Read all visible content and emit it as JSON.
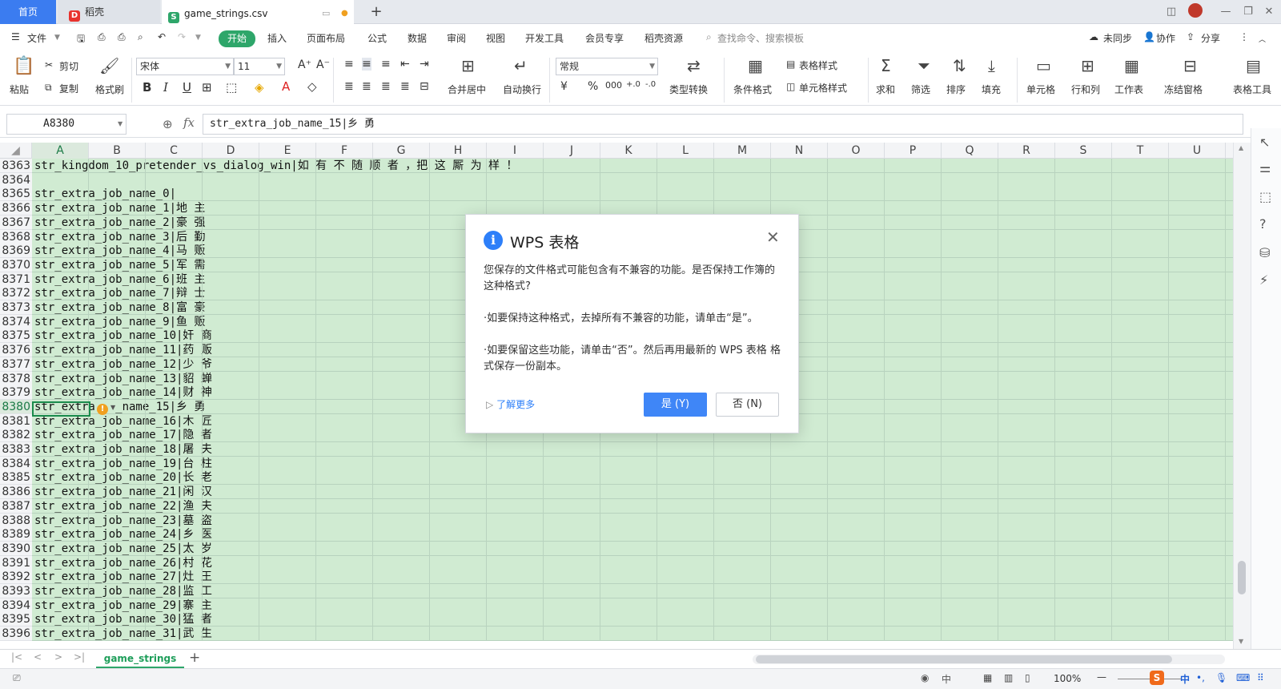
{
  "tabs": {
    "home": "首页",
    "docer": "稻壳",
    "file": "game_strings.csv"
  },
  "menu": [
    "文件",
    "开始",
    "插入",
    "页面布局",
    "公式",
    "数据",
    "审阅",
    "视图",
    "开发工具",
    "会员专享",
    "稻壳资源"
  ],
  "menu_search": "查找命令、搜索模板",
  "menu_right": {
    "sync": "未同步",
    "collab": "协作",
    "share": "分享"
  },
  "ribbon": {
    "paste": "粘贴",
    "cut": "剪切",
    "copy": "复制",
    "format_painter": "格式刷",
    "font": "宋体",
    "font_size": "11",
    "merge": "合并居中",
    "wrap": "自动换行",
    "number_format": "常规",
    "type_convert": "类型转换",
    "cond_format": "条件格式",
    "table_style": "表格样式",
    "cell_style": "单元格样式",
    "sum": "求和",
    "filter": "筛选",
    "sort": "排序",
    "fill": "填充",
    "cell": "单元格",
    "rowcol": "行和列",
    "sheet": "工作表",
    "freeze": "冻结窗格",
    "table_tools": "表格工具"
  },
  "name_box": "A8380",
  "formula": "str_extra_job_name_15|乡 勇",
  "columns": [
    "A",
    "B",
    "C",
    "D",
    "E",
    "F",
    "G",
    "H",
    "I",
    "J",
    "K",
    "L",
    "M",
    "N",
    "O",
    "P",
    "Q",
    "R",
    "S",
    "T",
    "U"
  ],
  "rows": [
    {
      "n": "8363",
      "v": "str_kingdom_10_pretender_vs_dialog_win|如 有 不 随 顺 者 ，把 这 厮 为 样 ！"
    },
    {
      "n": "8364",
      "v": ""
    },
    {
      "n": "8365",
      "v": "str_extra_job_name_0|"
    },
    {
      "n": "8366",
      "v": "str_extra_job_name_1|地 主"
    },
    {
      "n": "8367",
      "v": "str_extra_job_name_2|豪 强"
    },
    {
      "n": "8368",
      "v": "str_extra_job_name_3|后 勤"
    },
    {
      "n": "8369",
      "v": "str_extra_job_name_4|马 贩"
    },
    {
      "n": "8370",
      "v": "str_extra_job_name_5|军 需"
    },
    {
      "n": "8371",
      "v": "str_extra_job_name_6|班 主"
    },
    {
      "n": "8372",
      "v": "str_extra_job_name_7|辩 士"
    },
    {
      "n": "8373",
      "v": "str_extra_job_name_8|富 豪"
    },
    {
      "n": "8374",
      "v": "str_extra_job_name_9|鱼 贩"
    },
    {
      "n": "8375",
      "v": "str_extra_job_name_10|奸 商"
    },
    {
      "n": "8376",
      "v": "str_extra_job_name_11|药 贩"
    },
    {
      "n": "8377",
      "v": "str_extra_job_name_12|少 爷"
    },
    {
      "n": "8378",
      "v": "str_extra_job_name_13|貂 蝉"
    },
    {
      "n": "8379",
      "v": "str_extra_job_name_14|财 神"
    },
    {
      "n": "8380",
      "v": "str_extra   _name_15|乡 勇"
    },
    {
      "n": "8381",
      "v": "str_extra_job_name_16|木 匠"
    },
    {
      "n": "8382",
      "v": "str_extra_job_name_17|隐 者"
    },
    {
      "n": "8383",
      "v": "str_extra_job_name_18|屠 夫"
    },
    {
      "n": "8384",
      "v": "str_extra_job_name_19|台 柱"
    },
    {
      "n": "8385",
      "v": "str_extra_job_name_20|长 老"
    },
    {
      "n": "8386",
      "v": "str_extra_job_name_21|闲 汉"
    },
    {
      "n": "8387",
      "v": "str_extra_job_name_22|渔 夫"
    },
    {
      "n": "8388",
      "v": "str_extra_job_name_23|墓 盗"
    },
    {
      "n": "8389",
      "v": "str_extra_job_name_24|乡 医"
    },
    {
      "n": "8390",
      "v": "str_extra_job_name_25|太 岁"
    },
    {
      "n": "8391",
      "v": "str_extra_job_name_26|村 花"
    },
    {
      "n": "8392",
      "v": "str_extra_job_name_27|灶 王"
    },
    {
      "n": "8393",
      "v": "str_extra_job_name_28|监 工"
    },
    {
      "n": "8394",
      "v": "str_extra_job_name_29|寨 主"
    },
    {
      "n": "8395",
      "v": "str_extra_job_name_30|猛 者"
    },
    {
      "n": "8396",
      "v": "str_extra_job_name_31|武 生"
    }
  ],
  "sheet_tab": "game_strings",
  "zoom": "100%",
  "ime": "中",
  "dialog": {
    "title": "WPS 表格",
    "msg1": "您保存的文件格式可能包含有不兼容的功能。是否保持工作簿的这种格式?",
    "msg2": "·如要保持这种格式，去掉所有不兼容的功能，请单击“是”。",
    "msg3": "·如要保留这些功能，请单击“否”。然后再用最新的 WPS 表格 格式保存一份副本。",
    "more": "了解更多",
    "yes": "是 (Y)",
    "no": "否 (N)"
  },
  "accent": "#2ea66a",
  "selection_fill": "#d0ebd2"
}
